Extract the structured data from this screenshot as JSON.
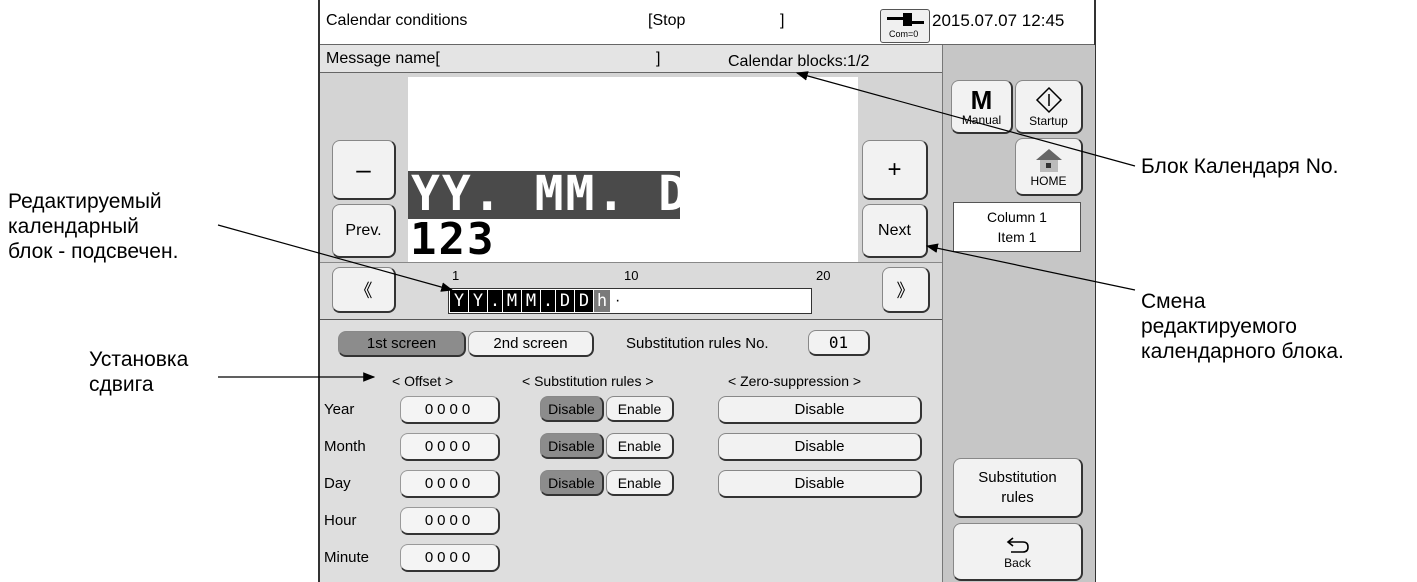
{
  "header": {
    "title": "Calendar conditions",
    "status": "[Stop",
    "status_close": "]",
    "com_label": "Com=0",
    "datetime": "2015.07.07 12:45"
  },
  "subheader": {
    "message_name": "Message name[",
    "message_close": "]",
    "calendar_blocks": "Calendar blocks:1/2"
  },
  "preview": {
    "big_text": "YY. MM. DDh",
    "small_text": "123",
    "minus_label": "–",
    "prev_label": "Prev.",
    "plus_label": "+",
    "next_label": "Next"
  },
  "ruler": {
    "tick_1": "1",
    "tick_10": "10",
    "tick_20": "20",
    "left_scroll": "《",
    "right_scroll": "》",
    "chars": [
      "Y",
      "Y",
      ".",
      "M",
      "M",
      ".",
      "D",
      "D",
      "h"
    ],
    "tail": "·"
  },
  "tabs": {
    "first": "1st screen",
    "second": "2nd screen",
    "rules_label": "Substitution rules No.",
    "rules_no": "01"
  },
  "columns": {
    "offset": "< Offset >",
    "substitution": "< Substitution rules >",
    "zero": "< Zero-suppression >"
  },
  "rows": [
    {
      "label": "Year",
      "offset": "0000",
      "disable": "Disable",
      "enable": "Enable",
      "zero": "Disable"
    },
    {
      "label": "Month",
      "offset": "0000",
      "disable": "Disable",
      "enable": "Enable",
      "zero": "Disable"
    },
    {
      "label": "Day",
      "offset": "0000",
      "disable": "Disable",
      "enable": "Enable",
      "zero": "Disable"
    },
    {
      "label": "Hour",
      "offset": "0000"
    },
    {
      "label": "Minute",
      "offset": "0000"
    }
  ],
  "side": {
    "manual_letter": "M",
    "manual_label": "Manual",
    "startup_label": "Startup",
    "home_label": "HOME",
    "column_info": "Column 1",
    "item_info": "Item 1",
    "substitution_line1": "Substitution",
    "substitution_line2": "rules",
    "back_label": "Back"
  },
  "annotations": {
    "block_no": "Блок Календаря No.",
    "edited_1": "Редактируемый",
    "edited_2": "календарный",
    "edited_3": "блок - подсвечен.",
    "change_1": "Смена",
    "change_2": "редактируемого",
    "change_3": "календарного блока.",
    "offset_1": "Установка",
    "offset_2": "сдвига"
  },
  "colors": {
    "highlight": "#3a3a3a",
    "panel": "#c6c6c6",
    "screen": "#dedede"
  }
}
